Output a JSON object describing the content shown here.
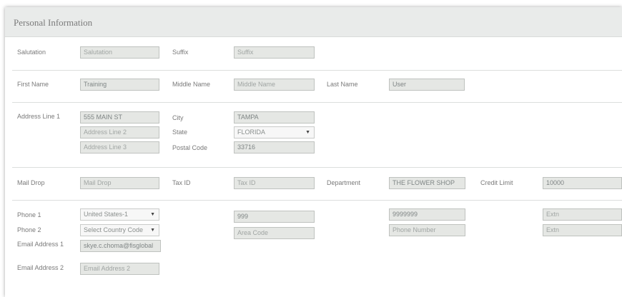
{
  "panel": {
    "title": "Personal Information"
  },
  "row1": {
    "salutation_label": "Salutation",
    "salutation_placeholder": "Salutation",
    "suffix_label": "Suffix",
    "suffix_placeholder": "Suffix"
  },
  "row2": {
    "first_name_label": "First Name",
    "first_name_value": "Training",
    "middle_name_label": "Middle Name",
    "middle_name_placeholder": "Middle Name",
    "last_name_label": "Last Name",
    "last_name_value": "User"
  },
  "address": {
    "line1_label": "Address Line 1",
    "line1_value": "555 MAIN ST",
    "line2_placeholder": "Address Line 2",
    "line3_placeholder": "Address Line 3",
    "city_label": "City",
    "city_value": "TAMPA",
    "state_label": "State",
    "state_value": "FLORIDA",
    "postal_label": "Postal Code",
    "postal_value": "33716"
  },
  "row4": {
    "mail_drop_label": "Mail Drop",
    "mail_drop_placeholder": "Mail Drop",
    "tax_id_label": "Tax ID",
    "tax_id_placeholder": "Tax ID",
    "department_label": "Department",
    "department_value": "THE FLOWER SHOP",
    "credit_limit_label": "Credit Limit",
    "credit_limit_value": "10000"
  },
  "contact": {
    "phone1_label": "Phone 1",
    "phone1_country": "United States-1",
    "phone1_area": "999",
    "phone1_number": "9999999",
    "phone1_ext_placeholder": "Extn",
    "phone2_label": "Phone 2",
    "phone2_country": "Select Country Code",
    "phone2_area_placeholder": "Area Code",
    "phone2_number_placeholder": "Phone Number",
    "phone2_ext_placeholder": "Extn",
    "email1_label": "Email Address 1",
    "email1_value": "skye.c.choma@fisglobal",
    "email2_label": "Email Address 2",
    "email2_placeholder": "Email Address 2"
  },
  "icons": {
    "dropdown": "chevron-down-icon"
  }
}
